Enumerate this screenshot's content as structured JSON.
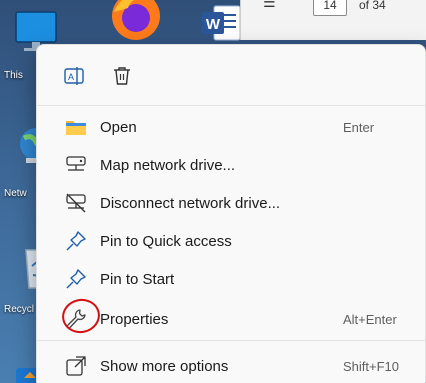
{
  "desktop": {
    "icons": [
      {
        "label": "This"
      },
      {
        "label": "Netw"
      },
      {
        "label": "Recycl"
      }
    ]
  },
  "word_toolbar": {
    "page_number": "14",
    "page_of": "of 34"
  },
  "menu": {
    "top_actions": [
      {
        "name": "rename-icon"
      },
      {
        "name": "delete-icon"
      }
    ],
    "items": [
      {
        "label": "Open",
        "shortcut": "Enter",
        "icon": "folder-icon"
      },
      {
        "label": "Map network drive...",
        "shortcut": "",
        "icon": "network-drive-icon"
      },
      {
        "label": "Disconnect network drive...",
        "shortcut": "",
        "icon": "disconnect-drive-icon"
      },
      {
        "label": "Pin to Quick access",
        "shortcut": "",
        "icon": "pin-icon"
      },
      {
        "label": "Pin to Start",
        "shortcut": "",
        "icon": "pin-icon"
      },
      {
        "label": "Properties",
        "shortcut": "Alt+Enter",
        "icon": "wrench-icon"
      },
      {
        "label": "Show more options",
        "shortcut": "Shift+F10",
        "icon": "more-options-icon"
      }
    ]
  },
  "colors": {
    "accent": "#0067c0",
    "annotation_circle": "#d40f12"
  }
}
